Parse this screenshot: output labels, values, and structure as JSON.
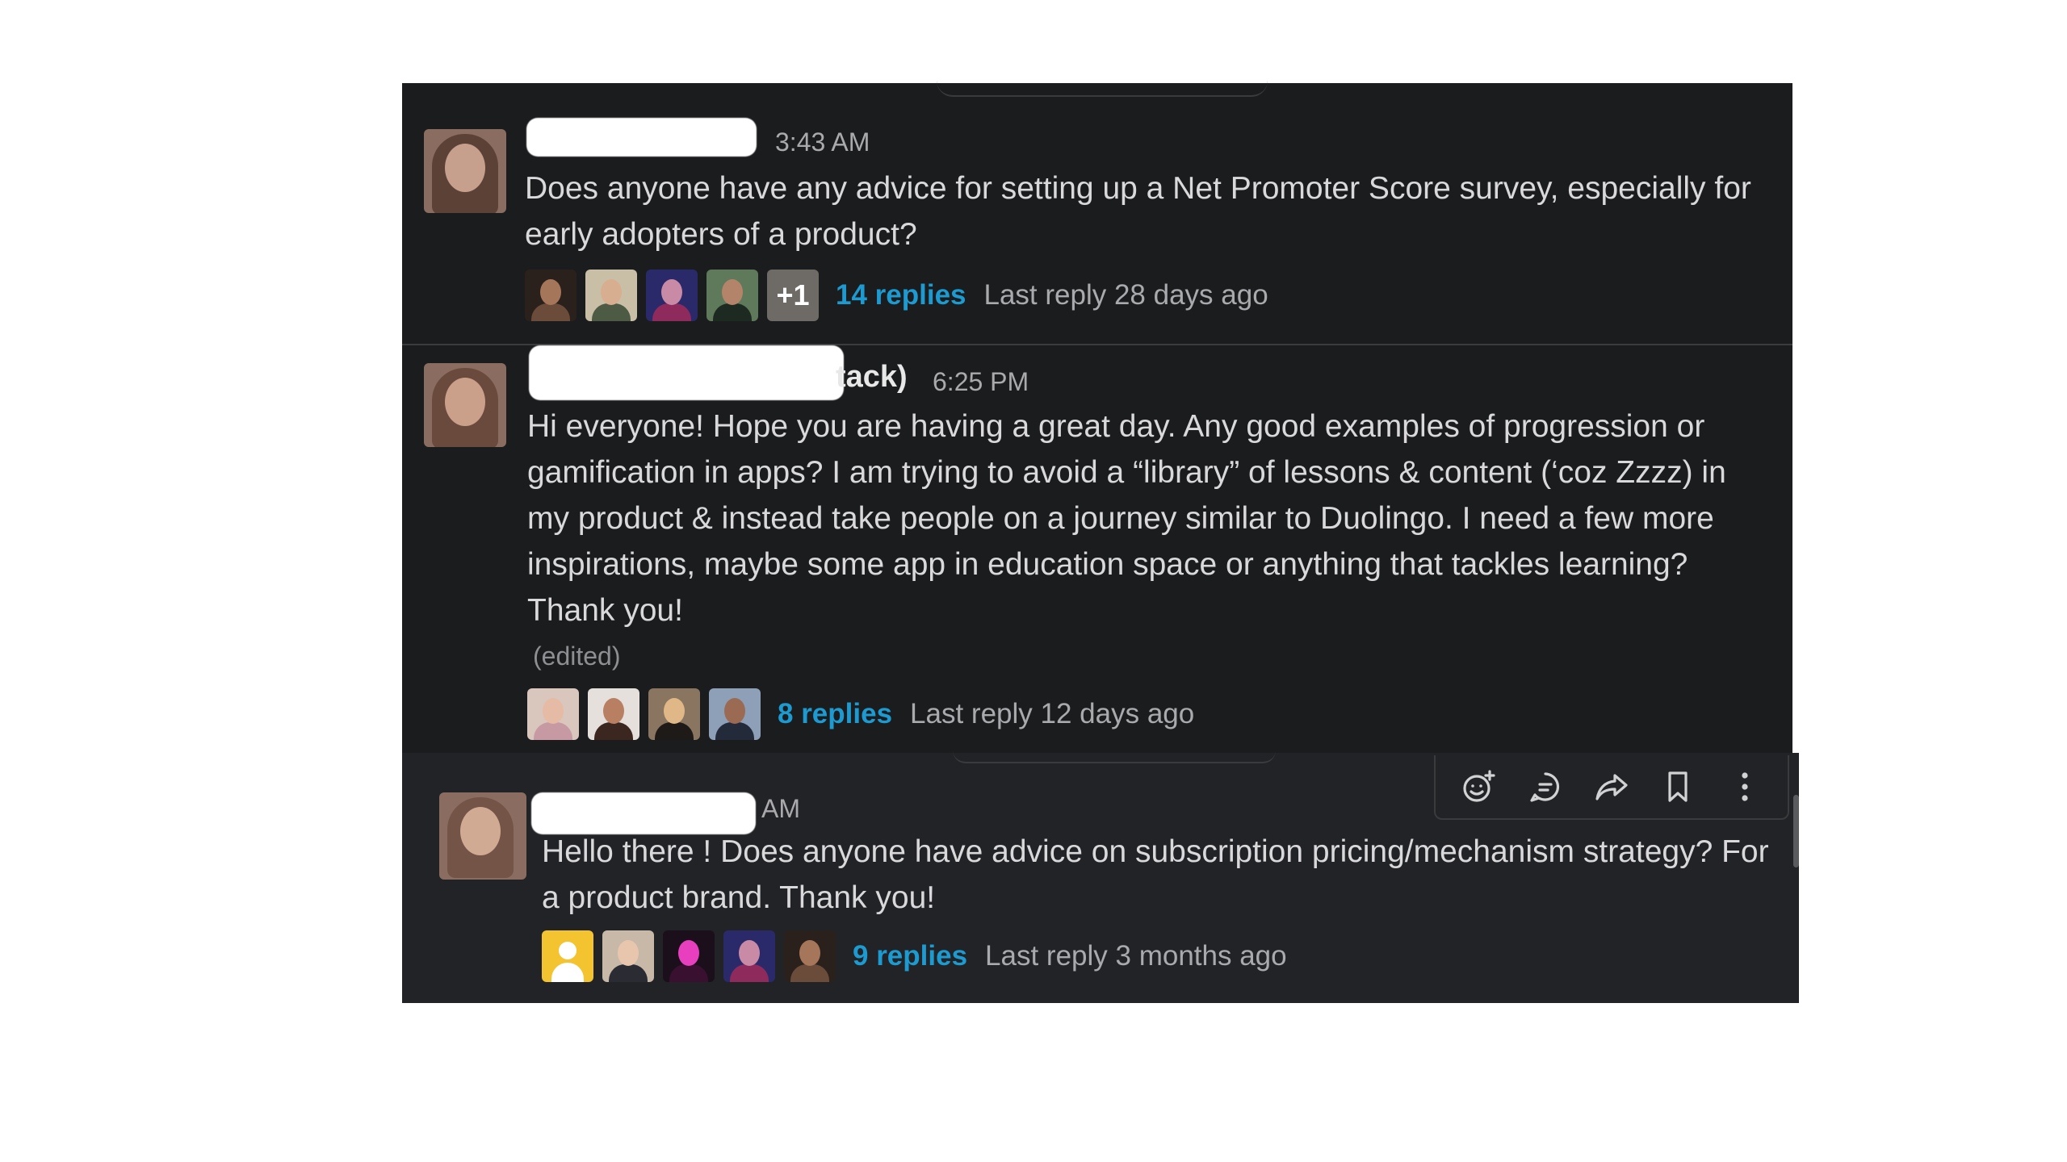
{
  "messages": [
    {
      "name_visible": "",
      "time": "3:43 AM",
      "text_line1": "Does anyone have any advice for setting up a Net Promoter Score survey, especially for",
      "text_line2": "early adopters of a product?",
      "reply_avatar_overflow": "+1",
      "replies_label": "14 replies",
      "last_reply": "Last reply 28 days ago"
    },
    {
      "name_visible": "tack)",
      "time": "6:25 PM",
      "text_lines": [
        "Hi everyone! Hope you are having a great day. Any good examples of progression or",
        "gamification in apps? I am trying to avoid a “library” of lessons & content (‘coz Zzzz) in",
        "my product & instead take people on a journey similar to Duolingo. I need a few more",
        "inspirations, maybe some app in education space or anything that tackles learning?",
        "Thank you!"
      ],
      "edited": "(edited)",
      "replies_label": "8 replies",
      "last_reply": "Last reply 12 days ago"
    },
    {
      "name_visible": "",
      "time": "AM",
      "text_line1": "Hello there ! Does anyone have advice on subscription pricing/mechanism strategy? For",
      "text_line2": "a product brand. Thank you!",
      "replies_label": "9 replies",
      "last_reply": "Last reply 3 months ago"
    }
  ],
  "toolbar": {
    "icons": [
      "add-reaction-icon",
      "reply-in-thread-icon",
      "share-icon",
      "bookmark-icon",
      "more-actions-icon"
    ]
  },
  "colors": {
    "background": "#1b1c1e",
    "hover_background": "#222326",
    "link": "#1d9bd1",
    "text": "#d9d9db",
    "muted": "#a9aaad"
  }
}
